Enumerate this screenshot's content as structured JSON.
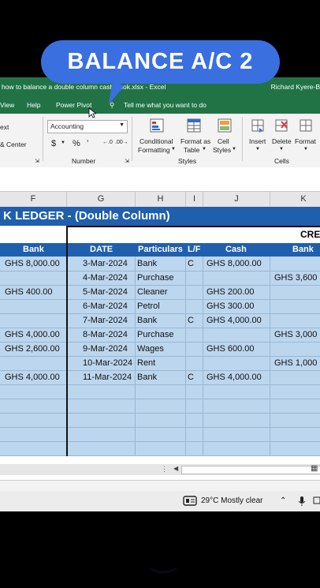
{
  "overlay": {
    "caption": "BALANCE A/C 2"
  },
  "window": {
    "title": "how to balance a double column cash book.xlsx  -  Excel",
    "user": "Richard Kyere-B"
  },
  "menu": {
    "items": [
      "View",
      "Help",
      "Power Pivot",
      "Tell me what you want to do"
    ]
  },
  "ribbon": {
    "text_cut": "ext",
    "merge_center": "& Center",
    "number_format": "Accounting",
    "number_group": "Number",
    "styles_group": "Styles",
    "cells_group": "Cells",
    "conditional_formatting": [
      "Conditional",
      "Formatting"
    ],
    "format_as_table": [
      "Format as",
      "Table"
    ],
    "cell_styles": [
      "Cell",
      "Styles"
    ],
    "insert": "Insert",
    "delete": "Delete",
    "format": "Format",
    "currency_symbol": "$",
    "percent_symbol": "%",
    "comma_symbol": "’",
    "inc_decimal": "←.0",
    "dec_decimal": ".00→"
  },
  "columns": [
    "F",
    "G",
    "H",
    "I",
    "J",
    "K"
  ],
  "sheet": {
    "title": "K LEDGER - (Double Column)",
    "credit_label": "CRE",
    "headers": {
      "bank_left": "Bank",
      "date": "DATE",
      "particulars": "Particulars",
      "lf": "L/F",
      "cash": "Cash",
      "bank_right": "Bank"
    },
    "rows": [
      {
        "bank_left": "GHS  8,000.00",
        "date": "3-Mar-2024",
        "particulars": "Bank",
        "lf": "C",
        "cash": "GHS  8,000.00",
        "bank_right": ""
      },
      {
        "bank_left": "",
        "date": "4-Mar-2024",
        "particulars": "Purchase",
        "lf": "",
        "cash": "",
        "bank_right": "GHS  3,600"
      },
      {
        "bank_left": "GHS     400.00",
        "date": "5-Mar-2024",
        "particulars": "Cleaner",
        "lf": "",
        "cash": "GHS     200.00",
        "bank_right": ""
      },
      {
        "bank_left": "",
        "date": "6-Mar-2024",
        "particulars": "Petrol",
        "lf": "",
        "cash": "GHS     300.00",
        "bank_right": ""
      },
      {
        "bank_left": "",
        "date": "7-Mar-2024",
        "particulars": "Bank",
        "lf": "C",
        "cash": "GHS  4,000.00",
        "bank_right": ""
      },
      {
        "bank_left": "GHS  4,000.00",
        "date": "8-Mar-2024",
        "particulars": "Purchase",
        "lf": "",
        "cash": "",
        "bank_right": "GHS  3,000"
      },
      {
        "bank_left": "GHS  2,600.00",
        "date": "9-Mar-2024",
        "particulars": "Wages",
        "lf": "",
        "cash": "GHS     600.00",
        "bank_right": ""
      },
      {
        "bank_left": "",
        "date": "10-Mar-2024",
        "particulars": "Rent",
        "lf": "",
        "cash": "",
        "bank_right": "GHS  1,000"
      },
      {
        "bank_left": "GHS  4,000.00",
        "date": "11-Mar-2024",
        "particulars": "Bank",
        "lf": "C",
        "cash": "GHS  4,000.00",
        "bank_right": ""
      }
    ]
  },
  "taskbar": {
    "weather": "29°C  Mostly clear"
  },
  "colors": {
    "excel_green": "#217346",
    "header_blue": "#1f5fae",
    "cell_blue": "#bcd6ee",
    "pill_blue": "#3a6fe0"
  }
}
